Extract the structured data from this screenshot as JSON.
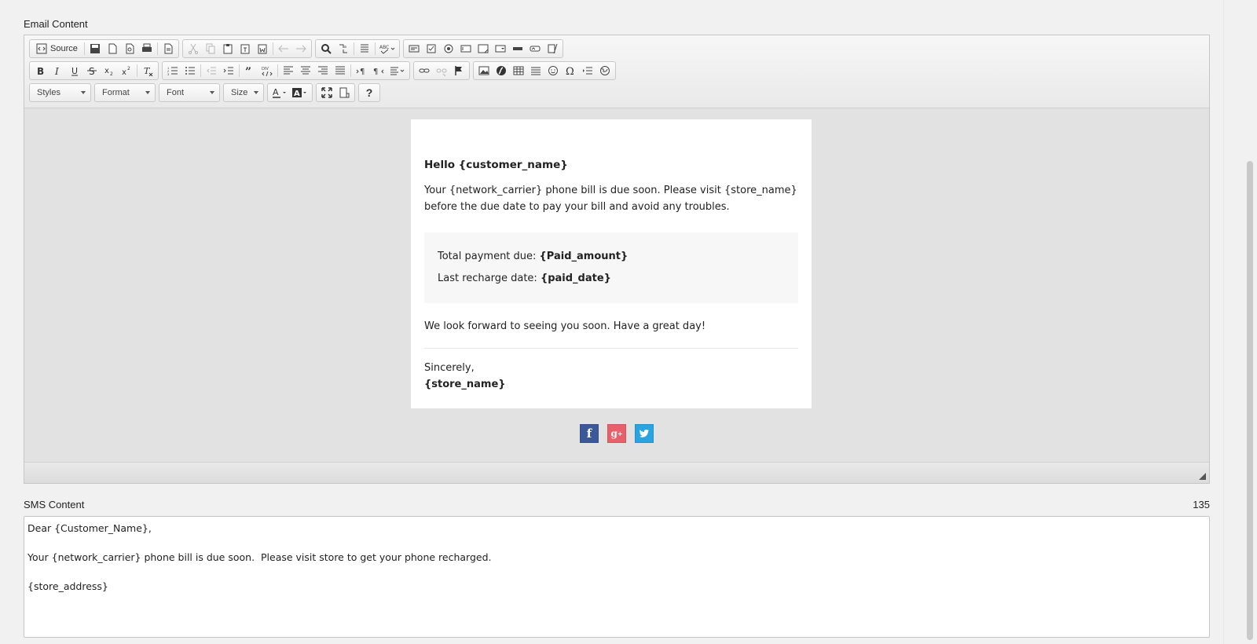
{
  "email": {
    "label": "Email Content",
    "toolbar": {
      "source_label": "Source",
      "styles_label": "Styles",
      "format_label": "Format",
      "font_label": "Font",
      "size_label": "Size",
      "help_label": "?"
    },
    "greeting": "Hello {customer_name}",
    "body": "Your {network_carrier} phone bill is due soon. Please visit {store_name} before the due date to pay your bill and avoid any troubles.",
    "payment_label": "Total payment due: ",
    "payment_value": "{Paid_amount}",
    "recharge_label": "Last recharge date: ",
    "recharge_value": "{paid_date}",
    "closing": "We look forward to seeing you soon. Have a great day!",
    "signoff": "Sincerely,",
    "signature": "{store_name}",
    "social": [
      "facebook-icon",
      "google-plus-icon",
      "twitter-icon"
    ]
  },
  "sms": {
    "label": "SMS Content",
    "count": "135",
    "text": "Dear {Customer_Name},\n\nYour {network_carrier} phone bill is due soon.  Please visit store to get your phone recharged.\n\n{store_address}"
  },
  "colors": {
    "facebook": "#3b5998",
    "google_plus": "#e8606a",
    "twitter": "#2aa3e0"
  }
}
